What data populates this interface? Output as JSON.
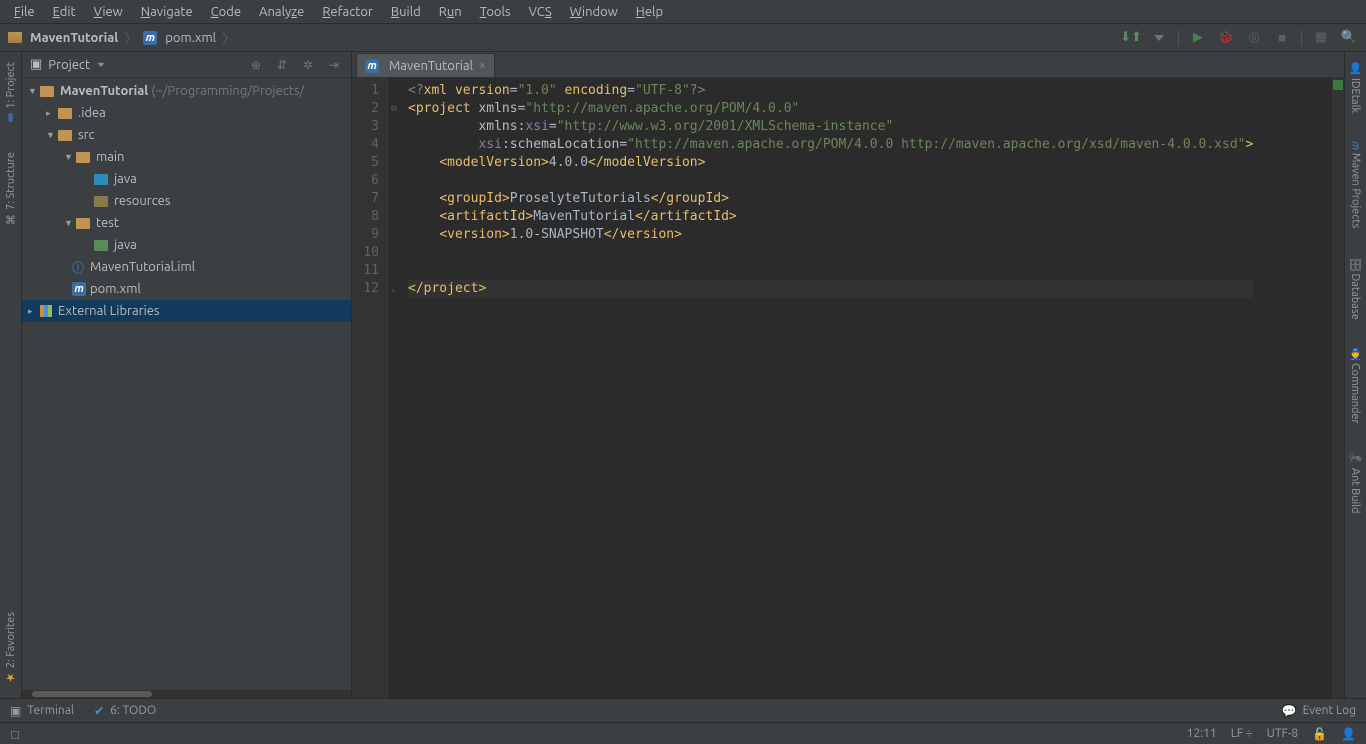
{
  "menu": [
    "File",
    "Edit",
    "View",
    "Navigate",
    "Code",
    "Analyze",
    "Refactor",
    "Build",
    "Run",
    "Tools",
    "VCS",
    "Window",
    "Help"
  ],
  "breadcrumb": {
    "root": "MavenTutorial",
    "file": "pom.xml"
  },
  "project_panel": {
    "title": "Project",
    "root_name": "MavenTutorial",
    "root_path": "(~/Programming/Projects/",
    "nodes": {
      "idea": ".idea",
      "src": "src",
      "main": "main",
      "main_java": "java",
      "resources": "resources",
      "test": "test",
      "test_java": "java",
      "iml": "MavenTutorial.iml",
      "pom": "pom.xml",
      "ext": "External Libraries"
    }
  },
  "editor_tab": "MavenTutorial",
  "code_lines": [
    "<?xml version=\"1.0\" encoding=\"UTF-8\"?>",
    "<project xmlns=\"http://maven.apache.org/POM/4.0.0\"",
    "         xmlns:xsi=\"http://www.w3.org/2001/XMLSchema-instance\"",
    "         xsi:schemaLocation=\"http://maven.apache.org/POM/4.0.0 http://maven.apache.org/xsd/maven-4.0.0.xsd\">",
    "    <modelVersion>4.0.0</modelVersion>",
    "",
    "    <groupId>ProselyteTutorials</groupId>",
    "    <artifactId>MavenTutorial</artifactId>",
    "    <version>1.0-SNAPSHOT</version>",
    "",
    "",
    "</project>"
  ],
  "left_tools": [
    {
      "label": "1: Project",
      "icon": "📁"
    },
    {
      "label": "7: Structure",
      "icon": "⌘"
    },
    {
      "label": "2: Favorites",
      "icon": "★"
    }
  ],
  "right_tools": [
    "IDEtalk",
    "Maven Projects",
    "Database",
    "Commander",
    "Ant Build"
  ],
  "bottom_tools": {
    "terminal": "Terminal",
    "todo": "6: TODO",
    "eventlog": "Event Log"
  },
  "status": {
    "pos": "12:11",
    "sep": "LF ÷",
    "enc": "UTF-8"
  }
}
